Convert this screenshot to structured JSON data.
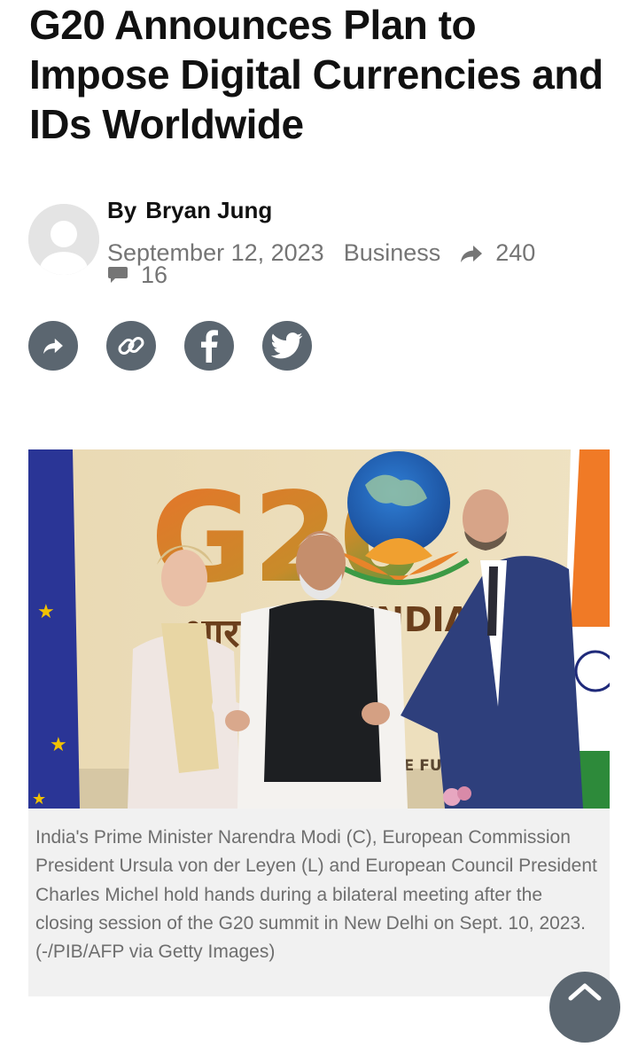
{
  "article": {
    "title": "G20 Announces Plan to Impose Digital Currencies and IDs Worldwide",
    "by_label": "By",
    "author": "Bryan Jung",
    "date": "September 12, 2023",
    "category": "Business",
    "share_count": "240",
    "comment_count": "16"
  },
  "image": {
    "caption": "India's Prime Minister Narendra Modi (C), European Commission President Ursula von der Leyen (L) and European Council President Charles Michel hold hands during a bilateral meeting after the closing session of the G20 summit in New Delhi on Sept. 10, 2023. (-/PIB/AFP via Getty Images)",
    "backdrop_text": {
      "logo": "G20",
      "hindi": "भारत",
      "india": "INDIA",
      "motto": "ONE FUTURE"
    }
  },
  "share_buttons": [
    {
      "icon": "share-icon"
    },
    {
      "icon": "link-icon"
    },
    {
      "icon": "facebook-icon"
    },
    {
      "icon": "twitter-icon"
    }
  ],
  "colors": {
    "title": "#111111",
    "meta": "#757575",
    "share_button_bg": "#5b6670",
    "caption_bg": "#f1f1f1",
    "caption_text": "#6e6e6e"
  }
}
